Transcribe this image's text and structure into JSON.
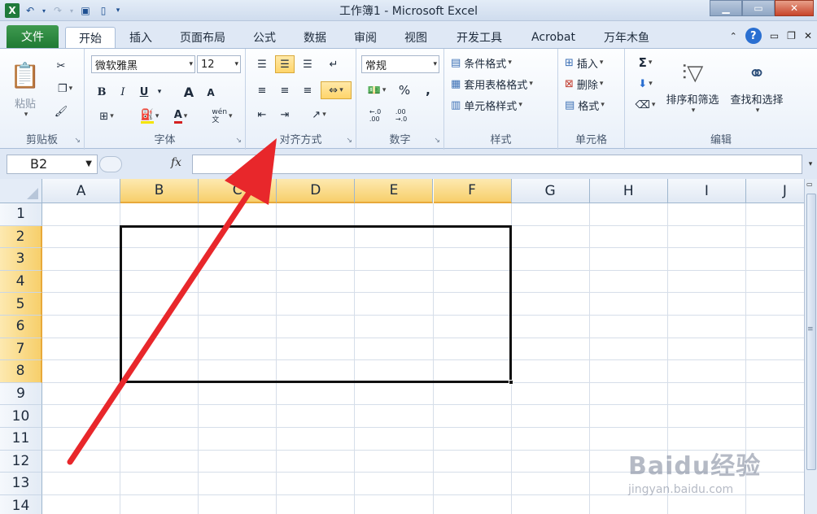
{
  "app": {
    "title": "工作簿1 - Microsoft Excel",
    "logo": "X"
  },
  "tabs": [
    "文件",
    "开始",
    "插入",
    "页面布局",
    "公式",
    "数据",
    "审阅",
    "视图",
    "开发工具",
    "Acrobat",
    "万年木鱼"
  ],
  "active_tab": "开始",
  "ribbon": {
    "clipboard": {
      "label": "剪贴板",
      "paste": "粘贴"
    },
    "font": {
      "label": "字体",
      "font_name": "微软雅黑",
      "font_size": "12",
      "bold": "B",
      "italic": "I",
      "underline": "U",
      "grow": "A",
      "shrink": "A",
      "font_color": "A",
      "phonetic": "wén\n文"
    },
    "alignment": {
      "label": "对齐方式"
    },
    "number": {
      "label": "数字",
      "format": "常规",
      "percent": "%",
      "comma": ",",
      "increase": "←.0\n.00",
      "decrease": ".00\n→.0"
    },
    "styles": {
      "label": "样式",
      "conditional": "条件格式",
      "table": "套用表格格式",
      "cell": "单元格样式"
    },
    "cells": {
      "label": "单元格",
      "insert": "插入",
      "delete": "删除",
      "format": "格式"
    },
    "editing": {
      "label": "编辑",
      "sum": "Σ",
      "sort": "排序和筛选",
      "find": "查找和选择"
    }
  },
  "formula_bar": {
    "name_box": "B2",
    "fx": "fx",
    "value": ""
  },
  "columns": [
    "A",
    "B",
    "C",
    "D",
    "E",
    "F",
    "G",
    "H",
    "I",
    "J"
  ],
  "highlighted_columns": [
    "B",
    "C",
    "D",
    "E",
    "F"
  ],
  "rows": [
    "1",
    "2",
    "3",
    "4",
    "5",
    "6",
    "7",
    "8",
    "9",
    "10",
    "11",
    "12",
    "13",
    "14"
  ],
  "highlighted_rows": [
    "2",
    "3",
    "4",
    "5",
    "6",
    "7",
    "8"
  ],
  "watermark": {
    "main": "Baidu经验",
    "sub": "jingyan.baidu.com"
  },
  "annotation": {
    "arrow_color": "#e8272b"
  }
}
